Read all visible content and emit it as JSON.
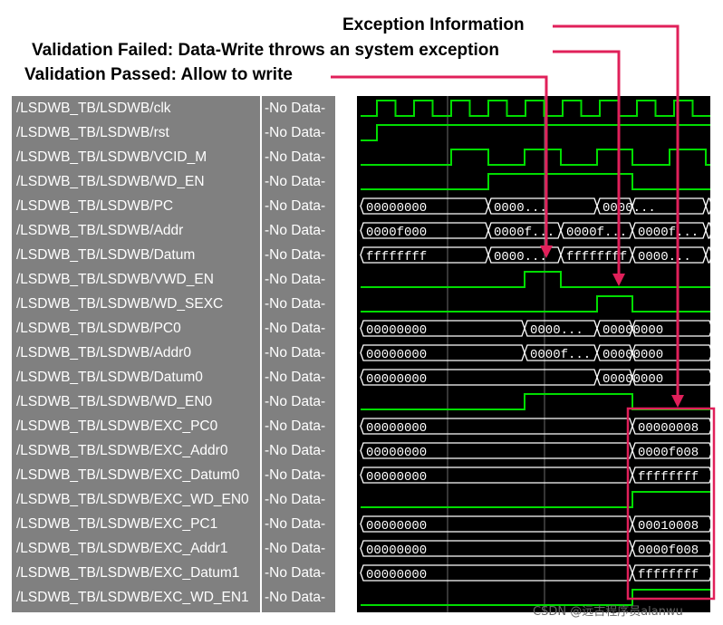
{
  "annotations": {
    "exception_info": "Exception Information",
    "validation_failed": "Validation Failed: Data-Write throws an system exception",
    "validation_passed": "Validation Passed: Allow to write"
  },
  "signals": [
    {
      "name": "/LSDWB_TB/LSDWB/clk",
      "value": "-No Data-"
    },
    {
      "name": "/LSDWB_TB/LSDWB/rst",
      "value": "-No Data-"
    },
    {
      "name": "/LSDWB_TB/LSDWB/VCID_M",
      "value": "-No Data-"
    },
    {
      "name": "/LSDWB_TB/LSDWB/WD_EN",
      "value": "-No Data-"
    },
    {
      "name": "/LSDWB_TB/LSDWB/PC",
      "value": "-No Data-"
    },
    {
      "name": "/LSDWB_TB/LSDWB/Addr",
      "value": "-No Data-"
    },
    {
      "name": "/LSDWB_TB/LSDWB/Datum",
      "value": "-No Data-"
    },
    {
      "name": "/LSDWB_TB/LSDWB/VWD_EN",
      "value": "-No Data-"
    },
    {
      "name": "/LSDWB_TB/LSDWB/WD_SEXC",
      "value": "-No Data-"
    },
    {
      "name": "/LSDWB_TB/LSDWB/PC0",
      "value": "-No Data-"
    },
    {
      "name": "/LSDWB_TB/LSDWB/Addr0",
      "value": "-No Data-"
    },
    {
      "name": "/LSDWB_TB/LSDWB/Datum0",
      "value": "-No Data-"
    },
    {
      "name": "/LSDWB_TB/LSDWB/WD_EN0",
      "value": "-No Data-"
    },
    {
      "name": "/LSDWB_TB/LSDWB/EXC_PC0",
      "value": "-No Data-"
    },
    {
      "name": "/LSDWB_TB/LSDWB/EXC_Addr0",
      "value": "-No Data-"
    },
    {
      "name": "/LSDWB_TB/LSDWB/EXC_Datum0",
      "value": "-No Data-"
    },
    {
      "name": "/LSDWB_TB/LSDWB/EXC_WD_EN0",
      "value": "-No Data-"
    },
    {
      "name": "/LSDWB_TB/LSDWB/EXC_PC1",
      "value": "-No Data-"
    },
    {
      "name": "/LSDWB_TB/LSDWB/EXC_Addr1",
      "value": "-No Data-"
    },
    {
      "name": "/LSDWB_TB/LSDWB/EXC_Datum1",
      "value": "-No Data-"
    },
    {
      "name": "/LSDWB_TB/LSDWB/EXC_WD_EN1",
      "value": "-No Data-"
    }
  ],
  "bus_values": {
    "pc": [
      "00000000",
      "0000...",
      "0000..."
    ],
    "addr": [
      "0000f000",
      "0000f...",
      "0000f...",
      "0000f..."
    ],
    "datum": [
      "ffffffff",
      "0000...",
      "ffffffff",
      "0000..."
    ],
    "pc0": [
      "00000000",
      "0000...",
      "00000000"
    ],
    "addr0": [
      "00000000",
      "0000f...",
      "00000000"
    ],
    "datum0": [
      "00000000",
      "00000000"
    ],
    "exc_pc0": [
      "00000000",
      "00000008"
    ],
    "exc_addr0": [
      "00000000",
      "0000f008"
    ],
    "exc_datum0": [
      "00000000",
      "ffffffff"
    ],
    "exc_pc1": [
      "00000000",
      "00010008"
    ],
    "exc_addr1": [
      "00000000",
      "0000f008"
    ],
    "exc_datum1": [
      "00000000",
      "ffffffff"
    ]
  },
  "colors": {
    "wave": "#00dd00",
    "bus": "#ffffff",
    "highlight": "#e0205a",
    "panel": "#808080"
  },
  "watermark": "CSDN @远古程序员alanwu"
}
